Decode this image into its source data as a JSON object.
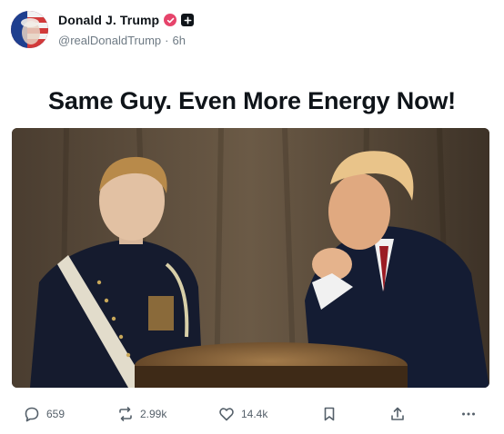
{
  "author": {
    "display_name": "Donald J. Trump",
    "handle": "@realDonaldTrump",
    "separator": "·",
    "time_ago": "6h"
  },
  "post": {
    "text": "Same Guy. Even More Energy Now!"
  },
  "actions": {
    "replies": "659",
    "reposts": "2.99k",
    "likes": "14.4k"
  },
  "icons": {
    "verified": "verified-check-icon",
    "plus": "plus-badge-icon",
    "reply": "reply-bubble-icon",
    "repost": "repost-icon",
    "like": "heart-icon",
    "bookmark": "bookmark-icon",
    "share": "share-icon",
    "more": "more-icon"
  },
  "colors": {
    "verified_badge": "#e6446b",
    "text_primary": "#0f1419",
    "text_secondary": "#6e7a84"
  }
}
